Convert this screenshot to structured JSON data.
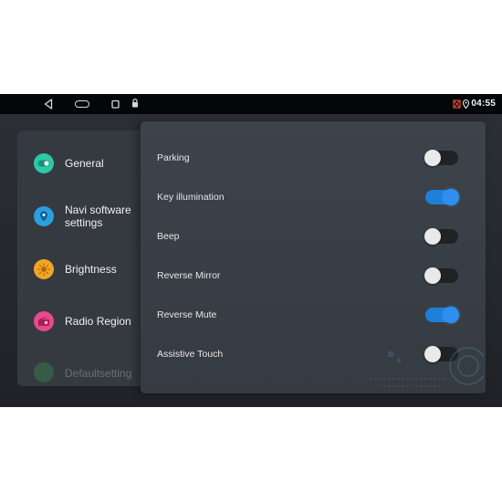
{
  "status_bar": {
    "time": "04:55",
    "nav_icons": [
      "back-icon",
      "home-icon",
      "recent-apps-icon",
      "lock-icon"
    ],
    "status_icons": [
      "no-signal-icon",
      "location-icon"
    ]
  },
  "sidebar": {
    "items": [
      {
        "label": "General",
        "icon": "toggle-icon",
        "color": "#2cc9a8"
      },
      {
        "label": "Navi software settings",
        "icon": "location-pin-icon",
        "color": "#2a9fe0"
      },
      {
        "label": "Brightness",
        "icon": "sun-icon",
        "color": "#f0a524"
      },
      {
        "label": "Radio Region",
        "icon": "radio-icon",
        "color": "#e64a8c"
      },
      {
        "label": "Defaultsetting",
        "icon": "reset-icon",
        "color": "#3bb45a"
      }
    ]
  },
  "settings": {
    "rows": [
      {
        "label": "Parking",
        "state": "off"
      },
      {
        "label": "Key illumination",
        "state": "on"
      },
      {
        "label": "Beep",
        "state": "off"
      },
      {
        "label": "Reverse Mirror",
        "state": "off"
      },
      {
        "label": "Reverse Mute",
        "state": "on"
      },
      {
        "label": "Assistive Touch",
        "state": "off"
      }
    ]
  },
  "colors": {
    "accent": "#1e7fd8",
    "background": "#2a2e34",
    "panel": "#3b4148"
  }
}
